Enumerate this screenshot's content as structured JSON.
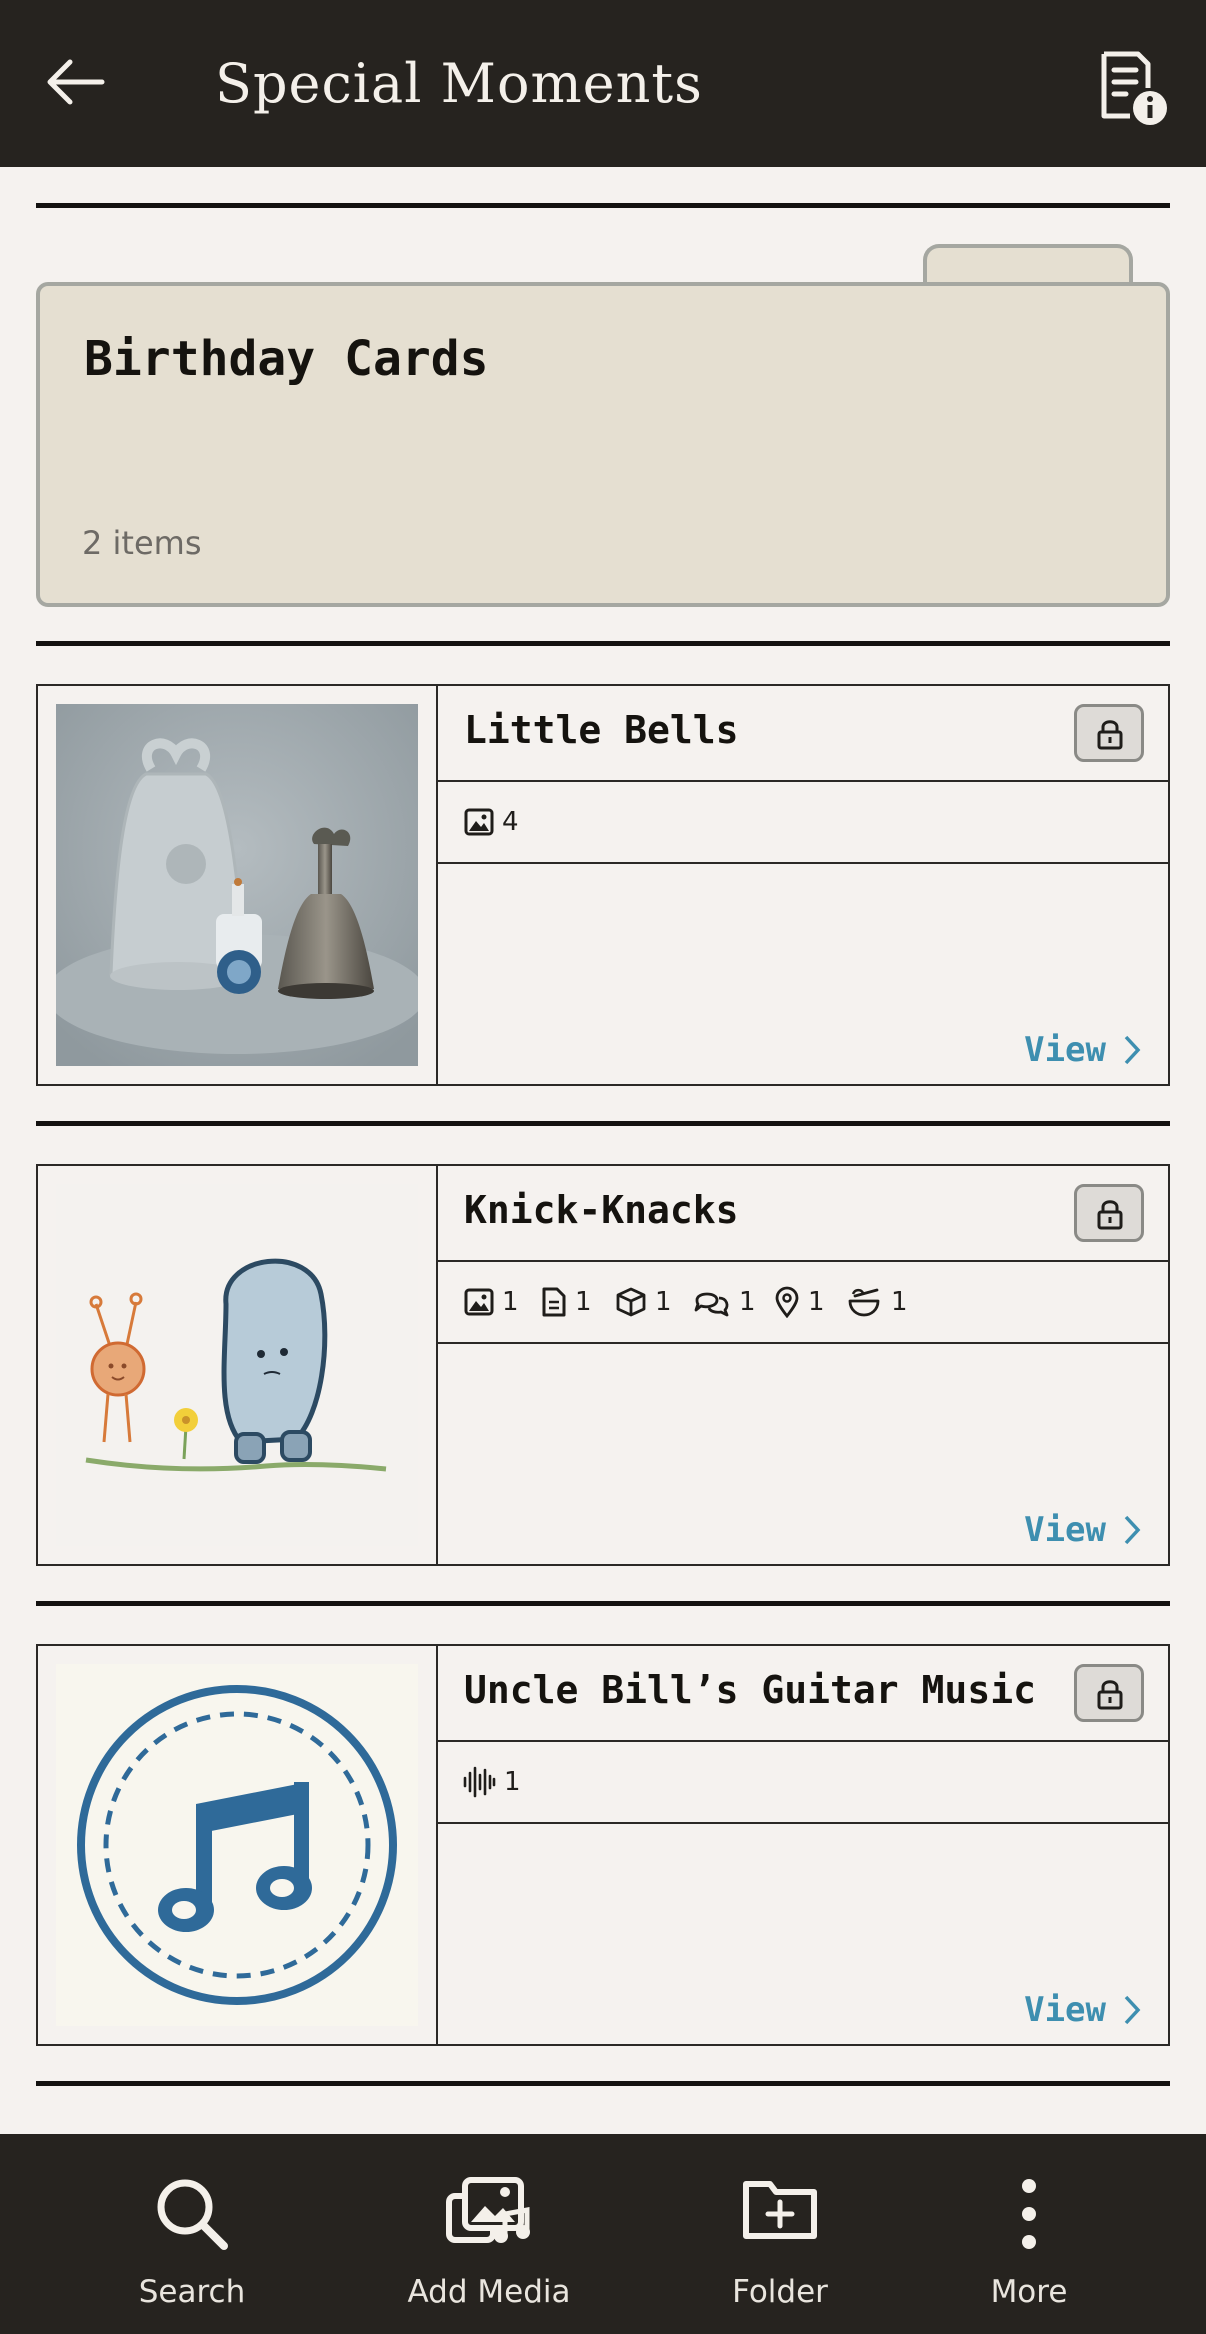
{
  "header": {
    "title": "Special Moments",
    "back_icon": "arrow-left-icon",
    "info_icon": "document-info-icon"
  },
  "folder": {
    "title": "Birthday Cards",
    "count": "2 items"
  },
  "cards": [
    {
      "title": "Little Bells",
      "meta": [
        {
          "icon": "image-icon",
          "count": "4"
        }
      ],
      "view_label": "View"
    },
    {
      "title": "Knick-Knacks",
      "meta": [
        {
          "icon": "image-icon",
          "count": "1"
        },
        {
          "icon": "document-icon",
          "count": "1"
        },
        {
          "icon": "box-icon",
          "count": "1"
        },
        {
          "icon": "chat-icon",
          "count": "1"
        },
        {
          "icon": "location-pin-icon",
          "count": "1"
        },
        {
          "icon": "bowl-icon",
          "count": "1"
        }
      ],
      "view_label": "View"
    },
    {
      "title": "Uncle Bill’s Guitar Music",
      "meta": [
        {
          "icon": "audio-waveform-icon",
          "count": "1"
        }
      ],
      "view_label": "View"
    }
  ],
  "bottom_nav": [
    {
      "label": "Search",
      "icon": "search-icon"
    },
    {
      "label": "Add Media",
      "icon": "add-media-icon"
    },
    {
      "label": "Folder",
      "icon": "folder-add-icon"
    },
    {
      "label": "More",
      "icon": "more-vertical-icon"
    }
  ],
  "colors": {
    "bar": "#26231f",
    "background": "#f5f2ef",
    "folder": "#e5dfd1",
    "link": "#3e8fb0",
    "music_blue": "#2f6a99"
  }
}
